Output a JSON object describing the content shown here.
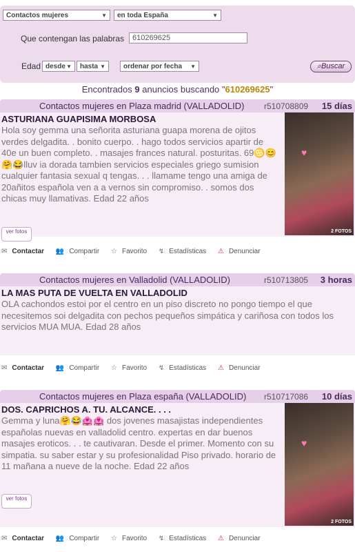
{
  "search": {
    "category_select": "Contactos mujeres",
    "region_select": "en toda España",
    "words_label": "Que contengan las palabras",
    "words_value": "610269625",
    "age_label": "Edad",
    "age_from": "desde",
    "age_to": "hasta",
    "sort_select": "ordenar por fecha",
    "search_button": "Buscar"
  },
  "results": {
    "prefix": "Encontrados",
    "count": "9",
    "middle": "anuncios buscando \"",
    "query": "610269625",
    "suffix": "\""
  },
  "actions": {
    "contact": "Contactar",
    "share": "Compartir",
    "favorite": "Favorito",
    "stats": "Estadísticas",
    "report": "Denunciar",
    "ver_fotos": "ver fotos"
  },
  "ads": [
    {
      "location": "Contactos mujeres en Plaza madrid (VALLADOLID)",
      "ref": "r510708809",
      "age": "15 días",
      "title": "ASTURIANA GUAPISIMA MORBOSA",
      "description": "Hola soy gemma una señorita asturiana guapa morena de ojitos verdes delgadita. . bonito cuerpo. . hago todos servicios apartir de 40e un buen completo. . masajes frances natural. posturitas. 69♋😊🤗😂lluv ia dorada tambien servicios especiales griego sumision cualquier fantasia sexual q tengas. . . llamame tengo una amiga de 20añitos española ven a a vernos sin compromiso. . somos dos chicas muy llamativas. Edad 22 años",
      "photos_label": "2 FOTOS"
    },
    {
      "location": "Contactos mujeres en Valladolid (VALLADOLID)",
      "ref": "r510713805",
      "age": "3 horas",
      "title": "LA MAS PUTA DE VUELTA EN VALLADOLID",
      "description": "OLA cachondos estoi por el centro en un piso discreto no pongo tiempo el que necesitemos soi delgadita con pechos pequeños simpática y cariñosa con todos los servicios MUA MUA. Edad 28 años"
    },
    {
      "location": "Contactos mujeres en Plaza españa (VALLADOLID)",
      "ref": "r510717086",
      "age": "10 días",
      "title": "DOS. CAPRICHOS A. TU. ALCANCE. . . .",
      "description": "Gemma y luna🤗😂🏩🏩 dos jovenes masajistas independientes españolas nuevas en valladolid centro. expertas en dar buenos masajes eroticos. . . te cautivaran. Desde el primer. Momento con su simpatia. su saber estar y su profesionalidad Piso privado. horario de 11 mañana a nueve de la noche. Edad 22 años",
      "photos_label": "2 FOTOS"
    }
  ]
}
